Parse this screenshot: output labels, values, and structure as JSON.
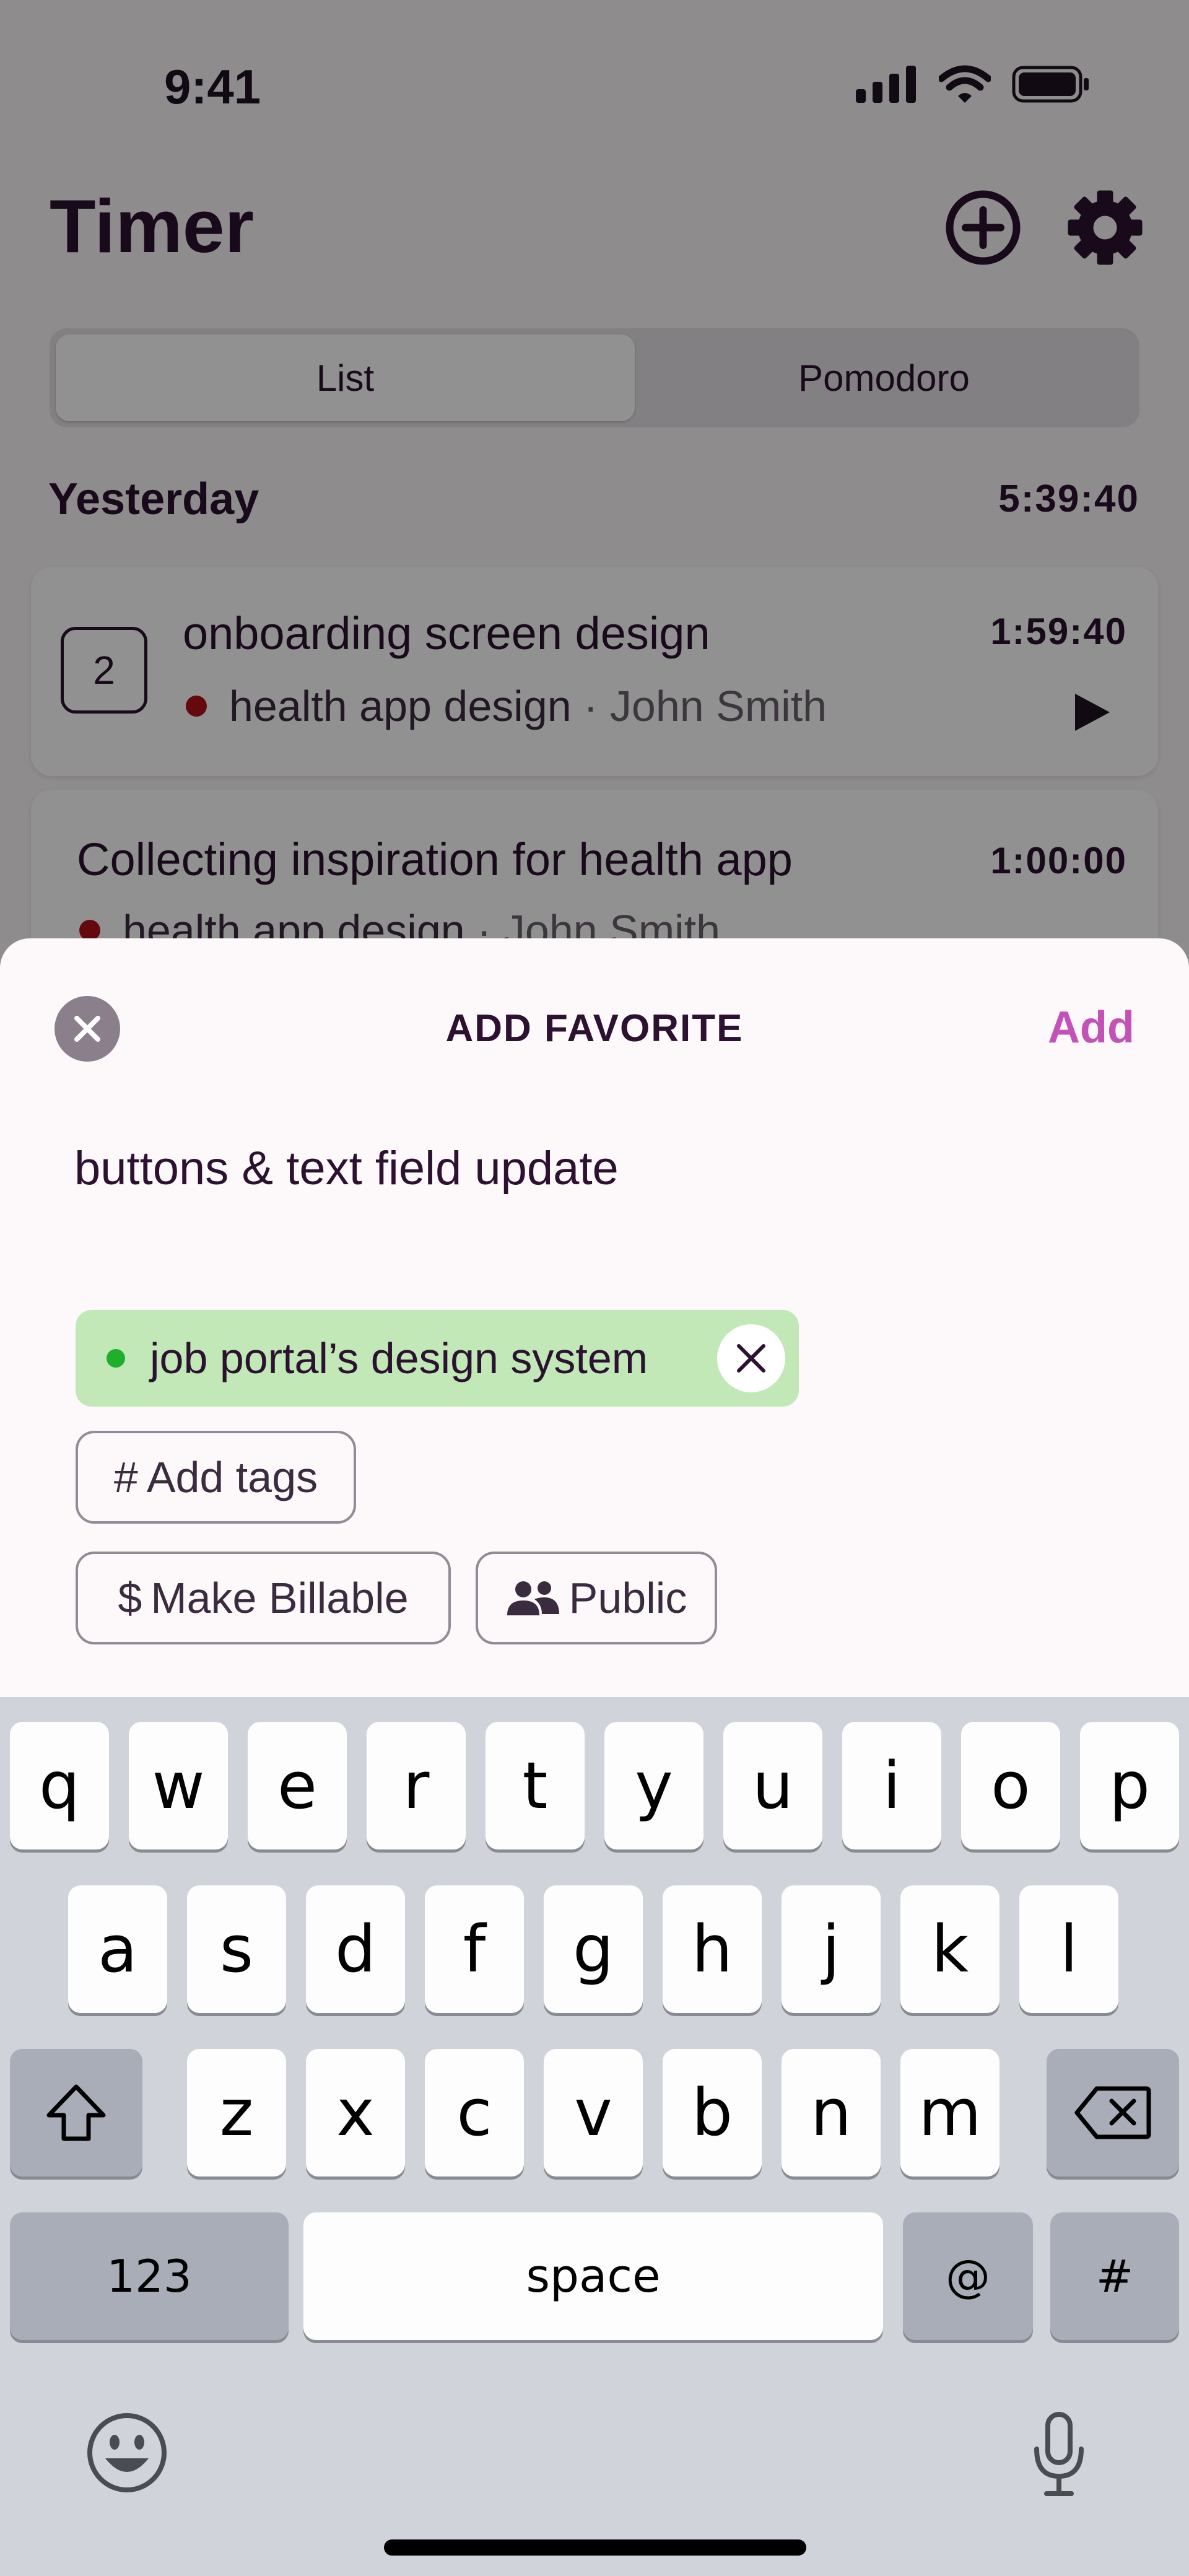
{
  "status_bar": {
    "time": "9:41"
  },
  "header": {
    "title": "Timer"
  },
  "segments": [
    "List",
    "Pomodoro"
  ],
  "day": {
    "label": "Yesterday",
    "total": "5:39:40"
  },
  "entries": [
    {
      "count": "2",
      "title": "onboarding screen design",
      "project": "health app design",
      "client": "· John Smith",
      "duration": "1:59:40"
    },
    {
      "title": "Collecting inspiration for health app",
      "project": "health app design",
      "client": "· John Smith",
      "duration": "1:00:00"
    }
  ],
  "sheet": {
    "title": "ADD FAVORITE",
    "add_label": "Add",
    "description_value": "buttons & text field update",
    "project_chip": "job portal’s design system",
    "tags_symbol": "#",
    "tags_label": "Add tags",
    "billable_symbol": "$",
    "billable_label": "Make Billable",
    "public_label": "Public"
  },
  "keyboard": {
    "row1": [
      "q",
      "w",
      "e",
      "r",
      "t",
      "y",
      "u",
      "i",
      "o",
      "p"
    ],
    "row2": [
      "a",
      "s",
      "d",
      "f",
      "g",
      "h",
      "j",
      "k",
      "l"
    ],
    "row3": [
      "z",
      "x",
      "c",
      "v",
      "b",
      "n",
      "m"
    ],
    "numbers_label": "123",
    "space_label": "space",
    "at_label": "@",
    "hash_label": "#"
  },
  "colors": {
    "accent": "#c252b8",
    "project_red": "#b0111a",
    "project_green": "#1fae2e",
    "chip_green": "#c1e8b6",
    "text_dark": "#2c1230"
  }
}
